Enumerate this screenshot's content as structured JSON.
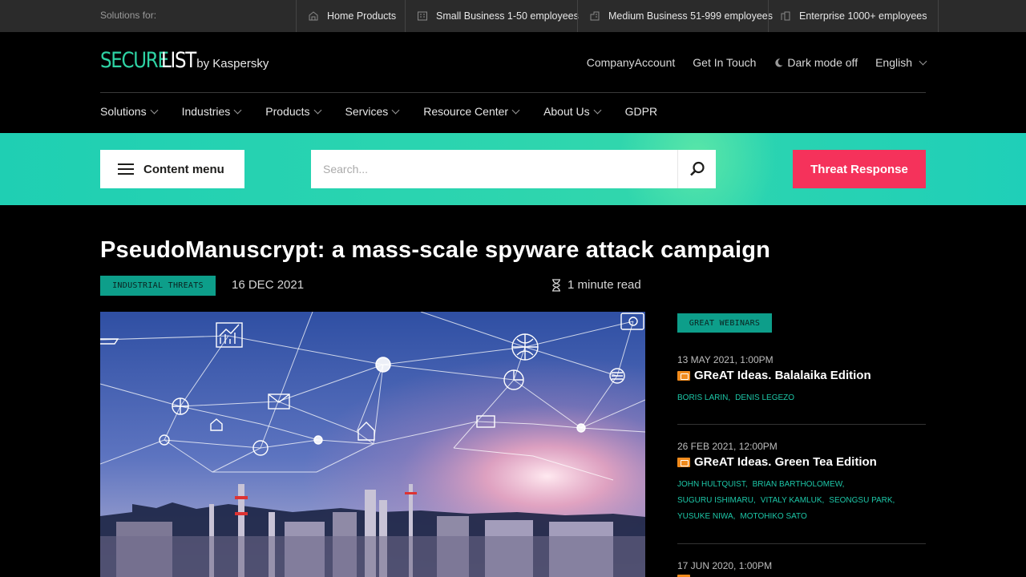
{
  "topbar": {
    "label": "Solutions for:",
    "segments": [
      {
        "label": "Home Products",
        "icon": "home-icon"
      },
      {
        "label": "Small Business 1-50 employees",
        "icon": "small-building-icon"
      },
      {
        "label": "Medium Business 51-999 employees",
        "icon": "medium-building-icon"
      },
      {
        "label": "Enterprise 1000+ employees",
        "icon": "enterprise-building-icon"
      }
    ]
  },
  "logo": {
    "part1": "SECURE",
    "part2": "LIST",
    "by": "by Kaspersky"
  },
  "header": {
    "account": "CompanyAccount",
    "contact": "Get In Touch",
    "darkmode": "Dark mode off",
    "language": "English"
  },
  "nav": [
    "Solutions",
    "Industries",
    "Products",
    "Services",
    "Resource Center",
    "About Us",
    "GDPR"
  ],
  "band": {
    "content_menu": "Content menu",
    "search_placeholder": "Search...",
    "threat_button": "Threat Response"
  },
  "article": {
    "title": "PseudoManuscrypt: a mass-scale spyware attack campaign",
    "tag": "INDUSTRIAL THREATS",
    "date": "16 DEC 2021",
    "read_time": "1 minute read"
  },
  "sidebar": {
    "tag": "GREAT WEBINARS",
    "webinars": [
      {
        "date": "13 MAY 2021, 1:00PM",
        "title": "GReAT Ideas. Balalaika Edition",
        "authors": [
          "BORIS LARIN,",
          "DENIS LEGEZO"
        ]
      },
      {
        "date": "26 FEB 2021, 12:00PM",
        "title": "GReAT Ideas. Green Tea Edition",
        "authors": [
          "JOHN HULTQUIST,",
          "BRIAN BARTHOLOMEW,",
          "SUGURU ISHIMARU,",
          "VITALY KAMLUK,",
          "SEONGSU PARK,",
          "YUSUKE NIWA,",
          "MOTOHIKO SATO"
        ]
      },
      {
        "date": "17 JUN 2020, 1:00PM"
      }
    ]
  },
  "colors": {
    "brand": "#2ed3a4",
    "threat": "#f5325b",
    "tag": "#0d9e8a",
    "author": "#1dc7a8"
  }
}
